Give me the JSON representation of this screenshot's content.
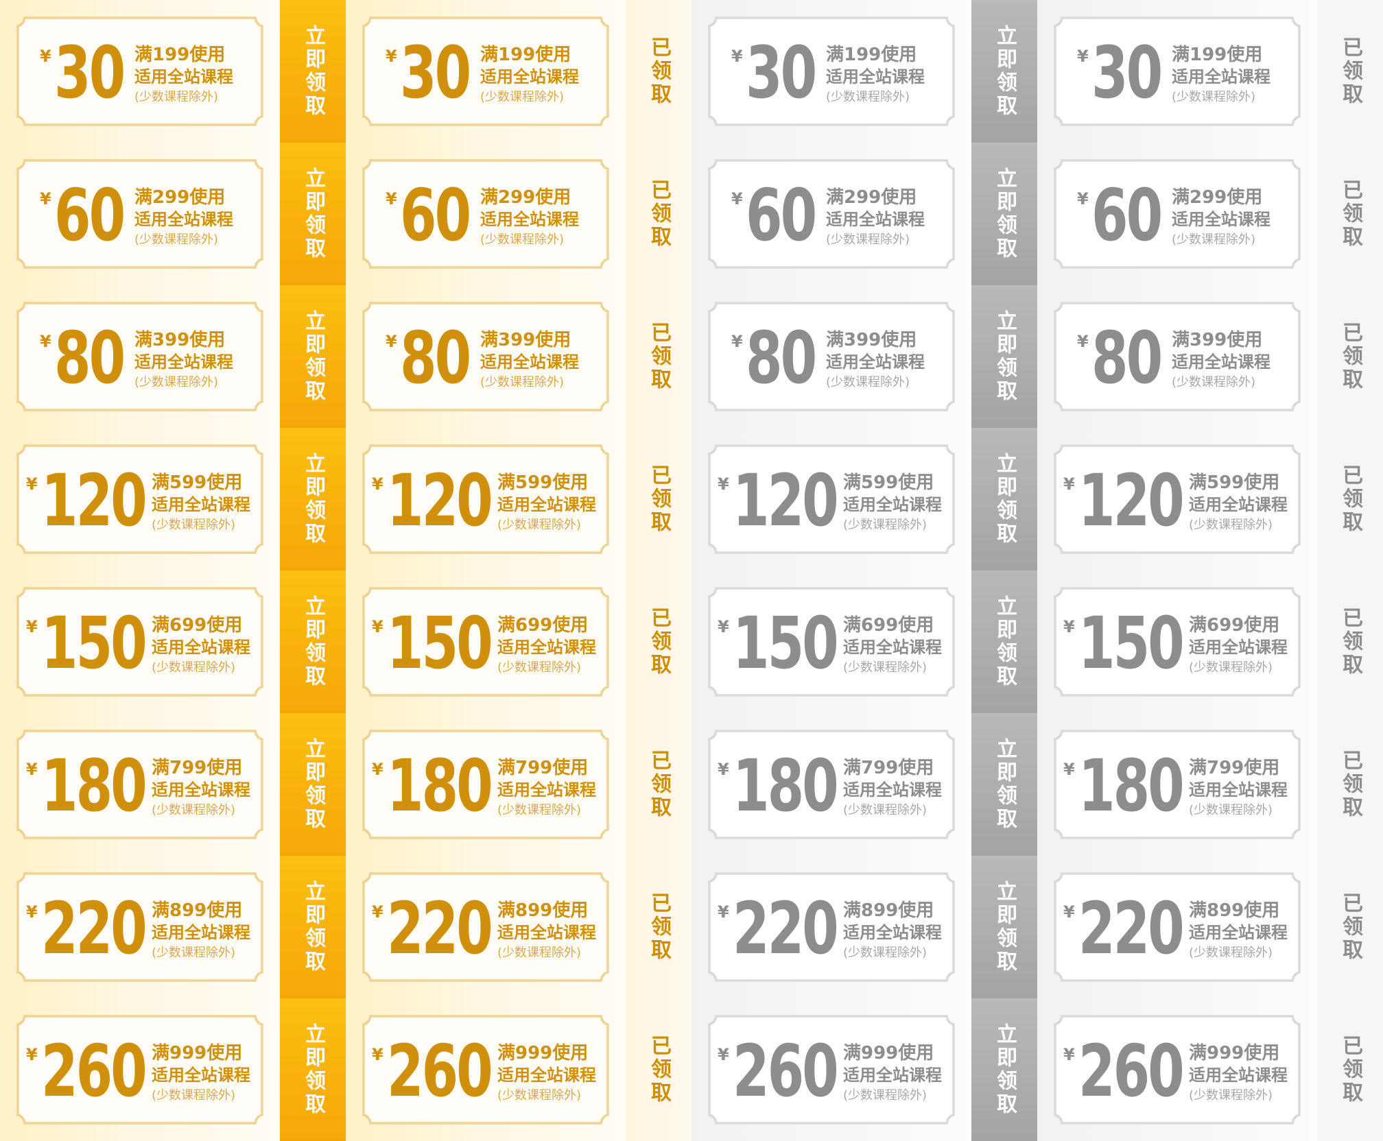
{
  "currency_symbol": "¥",
  "subtitle_line1": "适用全站课程",
  "subtitle_line2": "(少数课程除外)",
  "action_claim": "立即领取",
  "action_claimed": "已领取",
  "colors": {
    "gold_text": "#d1900b",
    "gold_button": "#f9b30d",
    "gray_text": "#8d8d8d",
    "gray_button": "#afafaf"
  },
  "columns": [
    {
      "theme": "gold",
      "status": "claim"
    },
    {
      "theme": "gold",
      "status": "claimed"
    },
    {
      "theme": "gray",
      "status": "claim"
    },
    {
      "theme": "gray",
      "status": "claimed"
    }
  ],
  "coupons": [
    {
      "amount": "30",
      "condition": "满199使用"
    },
    {
      "amount": "60",
      "condition": "满299使用"
    },
    {
      "amount": "80",
      "condition": "满399使用"
    },
    {
      "amount": "120",
      "condition": "满599使用"
    },
    {
      "amount": "150",
      "condition": "满699使用"
    },
    {
      "amount": "180",
      "condition": "满799使用"
    },
    {
      "amount": "220",
      "condition": "满899使用"
    },
    {
      "amount": "260",
      "condition": "满999使用"
    }
  ]
}
